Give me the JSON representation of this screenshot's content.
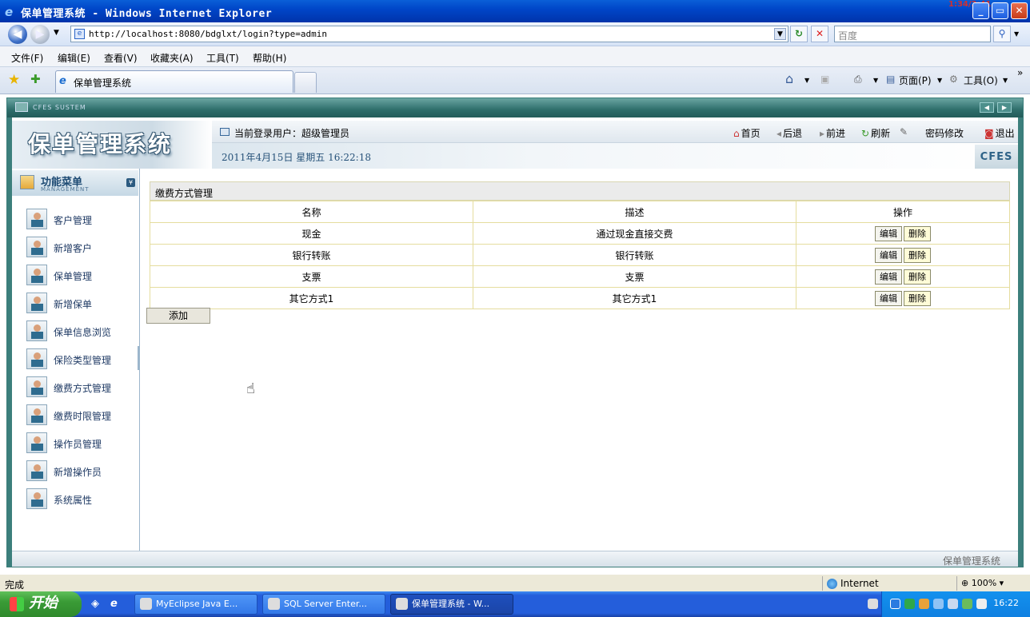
{
  "window": {
    "title": "保单管理系统 - Windows Internet Explorer",
    "clock_overlay": "1:34/2:41",
    "minimize_label": "_",
    "maximize_label": "▭",
    "close_label": "✕"
  },
  "browser": {
    "address": "http://localhost:8080/bdglxt/login?type=admin",
    "search_placeholder": "百度",
    "menu": [
      "文件(F)",
      "编辑(E)",
      "查看(V)",
      "收藏夹(A)",
      "工具(T)",
      "帮助(H)"
    ],
    "tab_title": "保单管理系统",
    "tools": {
      "page": "页面(P)",
      "tools": "工具(O)"
    },
    "status_text": "完成",
    "zone": "Internet",
    "zoom": "100%"
  },
  "app": {
    "frame_title": "CFES SUSTEM",
    "logo": "保单管理系统",
    "current_user_label": "当前登录用户：超级管理员",
    "datetime": "2011年4月15日  星期五  16:22:18",
    "brand": "CFES",
    "nav": {
      "home": "首页",
      "back": "后退",
      "forward": "前进",
      "refresh": "刷新",
      "change_password": "密码修改",
      "logout": "退出"
    },
    "sidebar": {
      "title": "功能菜单",
      "subtitle": "MANAGEMENT",
      "items": [
        "客户管理",
        "新增客户",
        "保单管理",
        "新增保单",
        "保单信息浏览",
        "保险类型管理",
        "缴费方式管理",
        "缴费时限管理",
        "操作员管理",
        "新增操作员",
        "系统属性"
      ]
    },
    "main": {
      "title": "缴费方式管理",
      "columns": [
        "名称",
        "描述",
        "操作"
      ],
      "rows": [
        {
          "name": "现金",
          "desc": "通过现金直接交费"
        },
        {
          "name": "银行转账",
          "desc": "银行转账"
        },
        {
          "name": "支票",
          "desc": "支票"
        },
        {
          "name": "其它方式1",
          "desc": "其它方式1"
        }
      ],
      "edit_label": "编辑",
      "delete_label": "删除",
      "add_label": "添加"
    },
    "footer": "保单管理系统"
  },
  "taskbar": {
    "start": "开始",
    "tasks": [
      "MyEclipse Java E...",
      "SQL Server Enter...",
      "保单管理系统 - W..."
    ],
    "time": "16:22"
  }
}
